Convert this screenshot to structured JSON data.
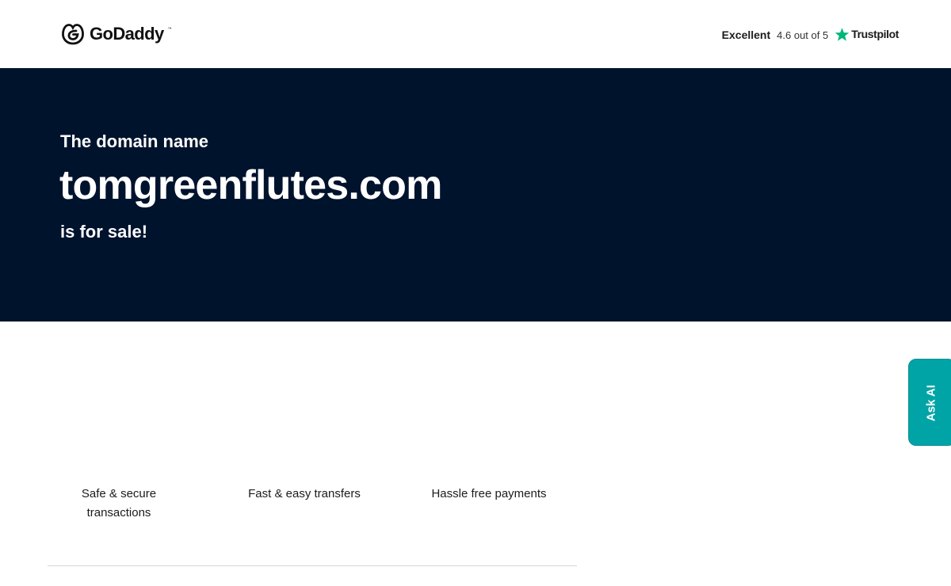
{
  "header": {
    "logo_text": "GoDaddy",
    "logo_tm": "™",
    "trustpilot": {
      "rating_word": "Excellent",
      "score": "4.6 out of 5",
      "brand": "Trustpilot",
      "star_color": "#00b67a"
    }
  },
  "hero": {
    "pre": "The domain name",
    "domain": "tomgreenflutes.com",
    "post": "is for sale!",
    "background": "#00132d"
  },
  "features": [
    {
      "label": "Safe & secure transactions"
    },
    {
      "label": "Fast & easy transfers"
    },
    {
      "label": "Hassle free payments"
    }
  ],
  "ask_ai": {
    "label": "Ask AI",
    "color": "#00a4a6"
  },
  "icons": {
    "logo": "godaddy-logo-icon",
    "star": "trustpilot-star-icon"
  }
}
